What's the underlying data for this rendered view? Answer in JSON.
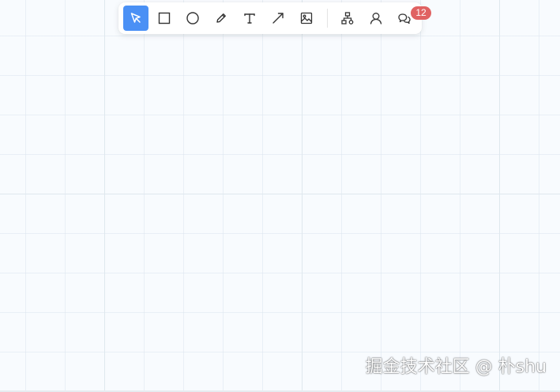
{
  "toolbar": {
    "tools": [
      {
        "name": "select",
        "icon": "cursor-arrow-icon",
        "active": true
      },
      {
        "name": "rectangle",
        "icon": "rectangle-icon",
        "active": false
      },
      {
        "name": "ellipse",
        "icon": "circle-icon",
        "active": false
      },
      {
        "name": "pen",
        "icon": "pencil-icon",
        "active": false
      },
      {
        "name": "text",
        "icon": "text-icon",
        "active": false
      },
      {
        "name": "arrow",
        "icon": "arrow-icon",
        "active": false
      },
      {
        "name": "image",
        "icon": "image-icon",
        "active": false
      },
      {
        "name": "structure",
        "icon": "sitemap-icon",
        "active": false
      },
      {
        "name": "collaborators",
        "icon": "user-icon",
        "active": false
      },
      {
        "name": "comments",
        "icon": "chat-bubbles-icon",
        "active": false
      }
    ],
    "comments_badge": "12"
  },
  "watermark": "掘金技术社区 @ 朴shu",
  "colors": {
    "canvas_background": "#f8fbfe",
    "grid_line": "#dfe8ee",
    "active_tool": "#4a90f5",
    "badge": "#e06262",
    "icon": "#333333"
  }
}
